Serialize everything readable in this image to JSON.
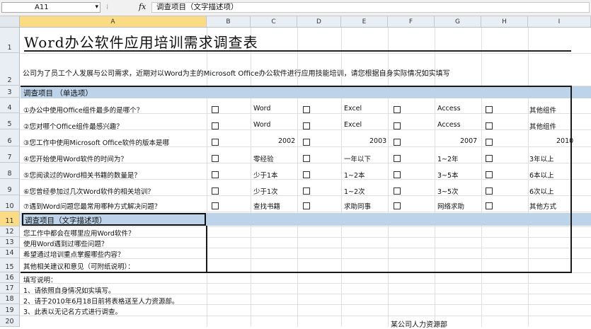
{
  "formula_bar": {
    "name_box": "A11",
    "fx": "fx",
    "content": "调查项目（文字描述项）"
  },
  "columns": [
    "A",
    "B",
    "C",
    "D",
    "E",
    "F",
    "G",
    "H",
    "I"
  ],
  "rows": [
    "1",
    "2",
    "3",
    "4",
    "5",
    "6",
    "7",
    "8",
    "9",
    "10",
    "11",
    "12",
    "13",
    "14",
    "15",
    "16",
    "17",
    "18",
    "19",
    "20"
  ],
  "sheet": {
    "title": "Word办公软件应用培训需求调查表",
    "intro": "公司为了员工个人发展与公司需求，近期对以Word为主的Microsoft Office办公软件进行应用技能培训，请您根据自身实际情况如实填写",
    "section1_header": "调查项目 （单选项）",
    "questions": [
      {
        "q": "①办公中使用Office组件最多的是哪个？",
        "opts": [
          "Word",
          "Excel",
          "Access",
          "其他组件"
        ]
      },
      {
        "q": "②您对哪个Office组件最感兴趣？",
        "opts": [
          "Word",
          "Excel",
          "Access",
          "其他组件"
        ]
      },
      {
        "q": "③您工作中使用Microsoft Office软件的版本是哪",
        "opts": [
          "2002",
          "2003",
          "2007",
          "2010"
        ]
      },
      {
        "q": "④您开始使用Word软件的时间为？",
        "opts": [
          "零经验",
          "一年以下",
          "1~2年",
          "3年以上"
        ]
      },
      {
        "q": "⑤您阅读过的Word相关书籍的数量是？",
        "opts": [
          "少于1本",
          "1~2本",
          "3~5本",
          "6本以上"
        ]
      },
      {
        "q": "⑥您曾经参加过几次Word软件的相关培训？",
        "opts": [
          "少于1次",
          "1~2次",
          "3~5次",
          "6次以上"
        ]
      },
      {
        "q": "⑦遇到Word问题您最常用哪种方式解决问题？",
        "opts": [
          "查找书籍",
          "求助同事",
          "网络求助",
          "其他方式"
        ]
      }
    ],
    "section2_header": "调查项目（文字描述项）",
    "text_items": [
      "您工作中都会在哪里应用Word软件？",
      "使用Word遇到过哪些问题？",
      "希望通过培训重点掌握哪些内容？",
      "其他相关建议和意见（可附纸说明）："
    ],
    "notes_title": "填写说明：",
    "notes": [
      "1、请依照自身情况如实填写。",
      "2、请于2010年6月18日前将表格送至人力资源部。",
      "3、此表以无记名方式进行调查。"
    ],
    "footer": "某公司人力资源部"
  },
  "colors": {
    "header_bg": "#e9eef4",
    "selected_header": "#fbdc84",
    "section_band": "#bcd3ea"
  }
}
